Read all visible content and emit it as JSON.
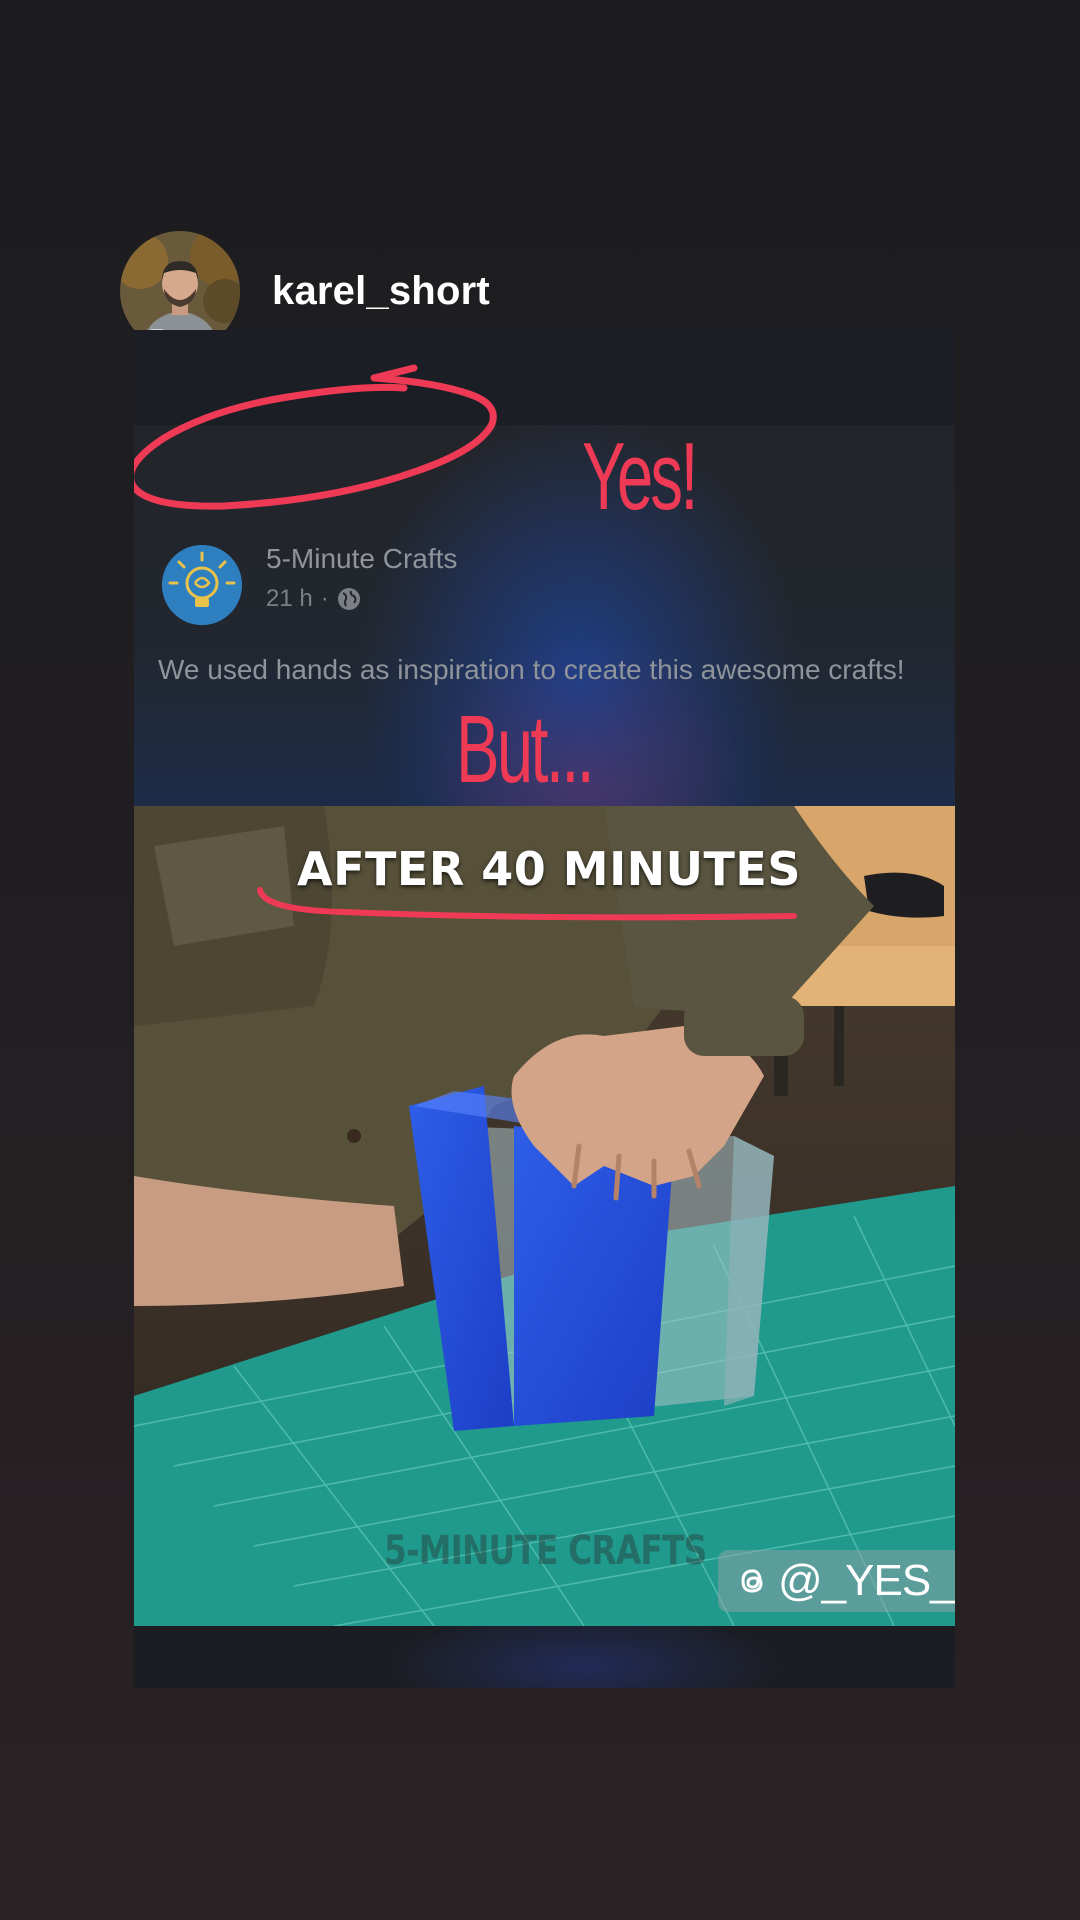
{
  "story": {
    "username": "karel_short"
  },
  "shared_post": {
    "page_name": "5-Minute Crafts",
    "time": "21 h",
    "separator": "·",
    "caption": "We used hands as inspiration to create this awesome crafts!"
  },
  "annotations": {
    "yes_text": "Yes!",
    "but_text": "But...",
    "accent_color": "#ee3a55"
  },
  "video": {
    "overlay_caption": "AFTER 40 MINUTES",
    "watermark": "5-MINUTE CRAFTS",
    "handle": "@_YES_BUT"
  }
}
